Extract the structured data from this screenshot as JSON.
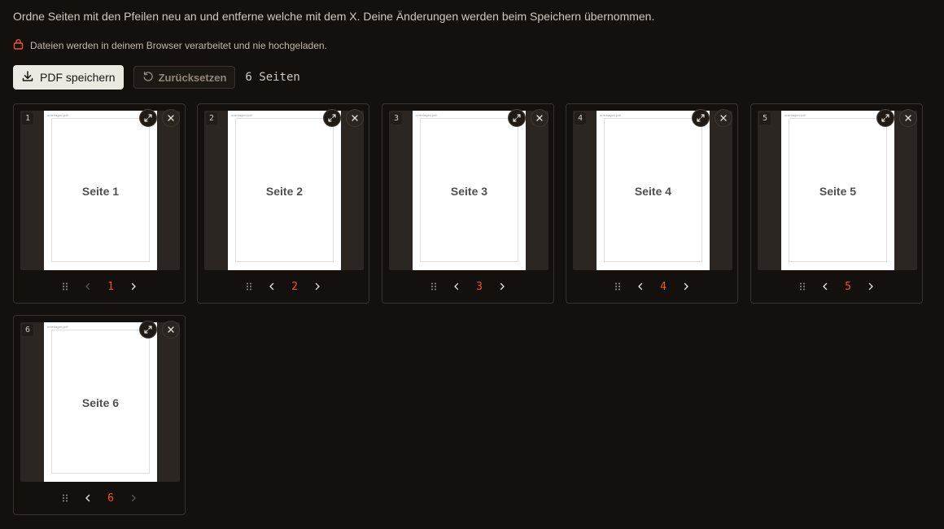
{
  "intro_text": "Ordne Seiten mit den Pfeilen neu an und entferne welche mit dem X. Deine Änderungen werden beim Speichern übernommen.",
  "privacy_text": "Dateien werden in deinem Browser verarbeitet und nie hochgeladen.",
  "toolbar": {
    "save_label": "PDF speichern",
    "reset_label": "Zurücksetzen",
    "page_count": "6 Seiten"
  },
  "colors": {
    "background": "#14100d",
    "accent": "#f0542c",
    "lock_icon": "#f0542c"
  },
  "pages": [
    {
      "badge": "1",
      "file": "unterlagen.pdf",
      "title": "Seite 1",
      "number": "1",
      "prev_enabled": false,
      "next_enabled": true
    },
    {
      "badge": "2",
      "file": "unterlagen.pdf",
      "title": "Seite 2",
      "number": "2",
      "prev_enabled": true,
      "next_enabled": true
    },
    {
      "badge": "3",
      "file": "unterlagen.pdf",
      "title": "Seite 3",
      "number": "3",
      "prev_enabled": true,
      "next_enabled": true
    },
    {
      "badge": "4",
      "file": "unterlagen.pdf",
      "title": "Seite 4",
      "number": "4",
      "prev_enabled": true,
      "next_enabled": true
    },
    {
      "badge": "5",
      "file": "unterlagen.pdf",
      "title": "Seite 5",
      "number": "5",
      "prev_enabled": true,
      "next_enabled": true
    },
    {
      "badge": "6",
      "file": "unterlagen.pdf",
      "title": "Seite 6",
      "number": "6",
      "prev_enabled": true,
      "next_enabled": false
    }
  ]
}
